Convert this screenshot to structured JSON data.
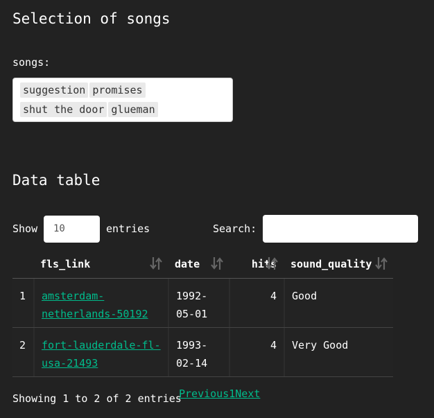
{
  "heading": "Selection of songs",
  "songs": {
    "label": "songs:",
    "selected": [
      "suggestion",
      "promises",
      "shut the door",
      "glueman"
    ]
  },
  "table_heading": "Data table",
  "controls": {
    "show_label": "Show",
    "length_value": "10",
    "entries_label": "entries",
    "search_label": "Search:",
    "search_value": ""
  },
  "table": {
    "columns": [
      "",
      "fls_link",
      "date",
      "hits",
      "sound_quality"
    ],
    "rows": [
      {
        "index": "1",
        "fls_link": "amsterdam-netherlands-50192",
        "date": "1992-05-01",
        "hits": "4",
        "sound_quality": "Good"
      },
      {
        "index": "2",
        "fls_link": "fort-lauderdale-fl-usa-21493",
        "date": "1993-02-14",
        "hits": "4",
        "sound_quality": "Very Good"
      }
    ]
  },
  "footer": {
    "info": "Showing 1 to 2 of 2 entries",
    "previous": "Previous",
    "page": "1",
    "next": "Next"
  },
  "colors": {
    "background": "#222222",
    "link": "#00bc8c"
  },
  "icons": {
    "sort": "sort-both-icon"
  }
}
